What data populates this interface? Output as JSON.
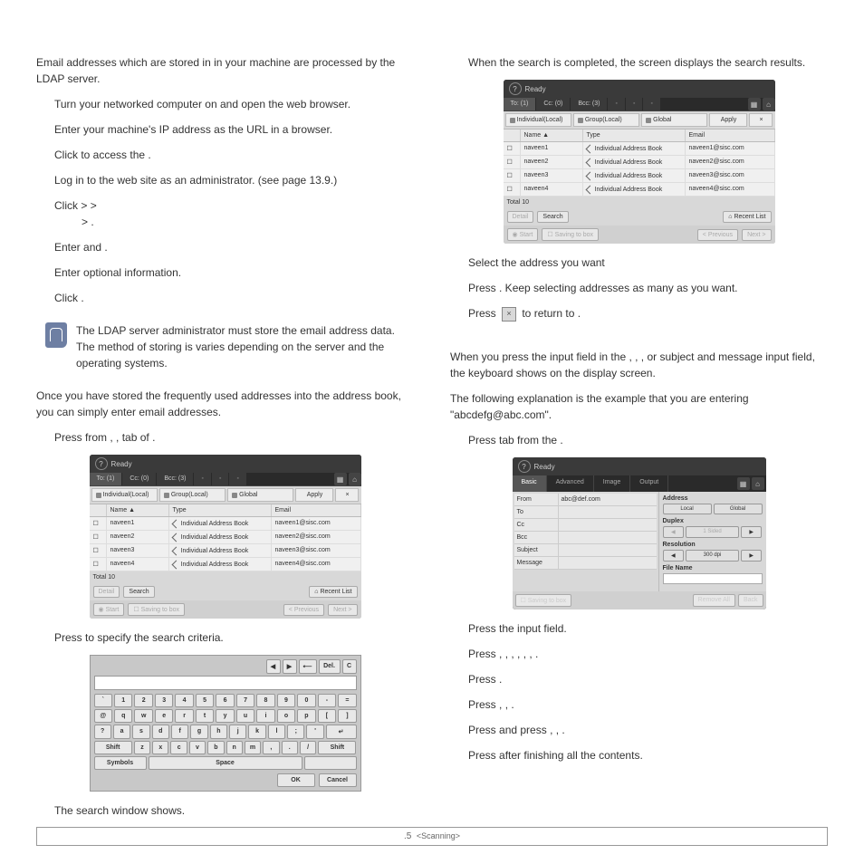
{
  "left": {
    "p1a": "Email addresses which are stored in ",
    "p1b": " in your machine are processed by the LDAP server.",
    "l1": "Turn your networked computer on and open the web browser.",
    "l2": "Enter your machine's IP address as the URL in a browser.",
    "l3a": "Click ",
    "l3b": " to access the ",
    "l3c": ".",
    "l4": "Log in to the web site as an administrator. (see  page 13.9.)",
    "l5a": "Click ",
    "l5b": " > ",
    "l5c": " > ",
    "l5d": " > ",
    "l5e": ".",
    "l6a": "Enter ",
    "l6b": " and ",
    "l6c": ".",
    "l7": "Enter optional information.",
    "l8a": "Click ",
    "l8b": ".",
    "note": "The LDAP server administrator must store the email address data. The method of storing is varies depending on the server and the operating systems.",
    "p2": "Once you have stored the frequently used addresses into the address book, you can simply enter email addresses.",
    "l9a": "Press ",
    "l9b": " from ",
    "l9c": ", ",
    "l9d": ", ",
    "l9e": " tab of ",
    "l9f": ".",
    "l10a": "Press ",
    "l10b": " to specify the search criteria.",
    "l11": "The search window shows."
  },
  "right": {
    "p1": "When the search is completed, the screen displays the search results.",
    "l1": "Select the address you want",
    "l2a": "Press ",
    "l2b": ". Keep selecting addresses as many as you want.",
    "l3a": "Press ",
    "l3b": " to return to ",
    "l3c": ".",
    "p2a": "When you press the input field in the ",
    "p2b": ", ",
    "p2c": ", ",
    "p2d": ", or subject and message input field, the keyboard shows on the display screen.",
    "p3": "The following explanation is the example that you are entering \"abcdefg@abc.com\".",
    "l4a": "Press ",
    "l4b": " tab from the ",
    "l4c": ".",
    "l5": "Press the input field.",
    "l6a": "Press ",
    "l6b": ", ",
    "l6c": ", ",
    "l6d": ", ",
    "l6e": ", ",
    "l6f": ", ",
    "l6g": ", ",
    "l6h": ".",
    "l7a": "Press ",
    "l7b": ".",
    "l8a": "Press ",
    "l8b": ", ",
    "l8c": ", ",
    "l8d": ".",
    "l9a": "Press ",
    "l9b": " and press ",
    "l9c": ", ",
    "l9d": ", ",
    "l9e": ".",
    "l10a": "Press ",
    "l10b": " after finishing all the contents."
  },
  "ui": {
    "ready": "Ready",
    "tab_to": "To: (1)",
    "tab_cc": "Cc: (0)",
    "tab_bcc": "Bcc: (3)",
    "filter_ind": "Individual(Local)",
    "filter_grp": "Group(Local)",
    "filter_glb": "Global",
    "apply": "Apply",
    "close_x": "×",
    "col_name": "Name",
    "col_type": "Type",
    "col_email": "Email",
    "r1_name": "naveen1",
    "r1_type": "Individual Address Book",
    "r1_email": "naveen1@sisc.com",
    "r2_name": "naveen2",
    "r2_type": "Individual Address Book",
    "r2_email": "naveen2@sisc.com",
    "r3_name": "naveen3",
    "r3_type": "Individual Address Book",
    "r3_email": "naveen3@sisc.com",
    "r4_name": "naveen4",
    "r4_type": "Individual Address Book",
    "r4_email": "naveen4@sisc.com",
    "total": "Total 10",
    "detail": "Detail",
    "search": "Search",
    "recent": "Recent List",
    "start": "Start",
    "saving": "Saving to box",
    "prev": "< Previous",
    "next": "Next >"
  },
  "kb": {
    "nav_l": "◀",
    "nav_r": "▶",
    "arrow_l": "⟵",
    "del": "Del.",
    "c": "C",
    "row1": [
      "`",
      "1",
      "2",
      "3",
      "4",
      "5",
      "6",
      "7",
      "8",
      "9",
      "0",
      "-",
      "="
    ],
    "row2": [
      "@",
      "q",
      "w",
      "e",
      "r",
      "t",
      "y",
      "u",
      "i",
      "o",
      "p",
      "[",
      "]"
    ],
    "row3": [
      "?",
      "a",
      "s",
      "d",
      "f",
      "g",
      "h",
      "j",
      "k",
      "l",
      ";",
      "'"
    ],
    "enter": "↵",
    "shift": "Shift",
    "row4": [
      "z",
      "x",
      "c",
      "v",
      "b",
      "n",
      "m",
      ",",
      ".",
      "/"
    ],
    "shift2": "Shift",
    "symbols": "Symbols",
    "space": "Space",
    "ok": "OK",
    "cancel": "Cancel"
  },
  "scan": {
    "ready": "Ready",
    "tab_basic": "Basic",
    "tab_adv": "Advanced",
    "tab_img": "Image",
    "tab_out": "Output",
    "from": "From",
    "from_val": "abc@def.com",
    "to": "To",
    "cc": "Cc",
    "bcc": "Bcc",
    "subj": "Subject",
    "msg": "Message",
    "addr": "Address",
    "local": "Local",
    "global": "Global",
    "duplex": "Duplex",
    "sided": "1 Sided",
    "res": "Resolution",
    "dpi": "300 dpi",
    "fname": "File Name",
    "saving": "Saving to box",
    "remove": "Remove All",
    "back": "Back"
  },
  "footer": {
    "num": ".5",
    "label": "<Scanning>"
  }
}
